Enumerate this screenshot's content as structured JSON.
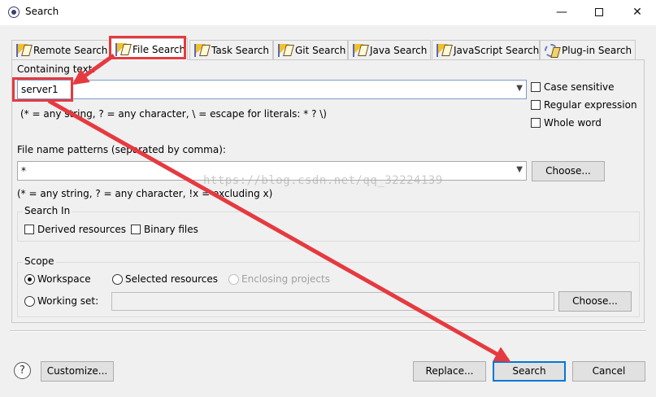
{
  "window": {
    "title": "Search",
    "min_glyph": "—",
    "close_glyph": "✕"
  },
  "tabs": [
    {
      "label": "Remote Search",
      "icon": "remote-search-icon",
      "active": false
    },
    {
      "label": "File Search",
      "icon": "file-search-icon",
      "active": true
    },
    {
      "label": "Task Search",
      "icon": "task-search-icon",
      "active": false
    },
    {
      "label": "Git Search",
      "icon": "git-search-icon",
      "active": false
    },
    {
      "label": "Java Search",
      "icon": "java-search-icon",
      "active": false
    },
    {
      "label": "JavaScript Search",
      "icon": "javascript-search-icon",
      "active": false
    },
    {
      "label": "Plug-in Search",
      "icon": "plugin-search-icon",
      "active": false
    }
  ],
  "containing": {
    "label": "Containing text:",
    "value": "server1",
    "hint": "(* = any string, ? = any character, \\ = escape for literals: * ? \\)",
    "case_sensitive": {
      "label": "Case sensitive",
      "checked": false
    },
    "regular_expression": {
      "label": "Regular expression",
      "checked": false
    },
    "whole_word": {
      "label": "Whole word",
      "checked": false
    }
  },
  "patterns": {
    "label": "File name patterns (separated by comma):",
    "value": "*",
    "hint": "(* = any string, ? = any character, !x = excluding x)",
    "choose_label": "Choose..."
  },
  "search_in": {
    "title": "Search In",
    "derived": {
      "label": "Derived resources",
      "checked": false
    },
    "binary": {
      "label": "Binary files",
      "checked": false
    }
  },
  "scope": {
    "title": "Scope",
    "workspace": {
      "label": "Workspace",
      "selected": true
    },
    "selected_resources": {
      "label": "Selected resources",
      "selected": false
    },
    "enclosing_projects": {
      "label": "Enclosing projects",
      "selected": false,
      "enabled": false
    },
    "working_set": {
      "label": "Working set:",
      "selected": false,
      "value": ""
    },
    "choose_label": "Choose..."
  },
  "footer": {
    "help_glyph": "?",
    "customize_label": "Customize...",
    "replace_label": "Replace...",
    "search_label": "Search",
    "cancel_label": "Cancel"
  },
  "watermark": "https://blog.csdn.net/qq_32224139",
  "colors": {
    "annotation": "#e53a3f",
    "focus_border": "#0078d7",
    "dialog_bg": "#f0f0f0"
  }
}
